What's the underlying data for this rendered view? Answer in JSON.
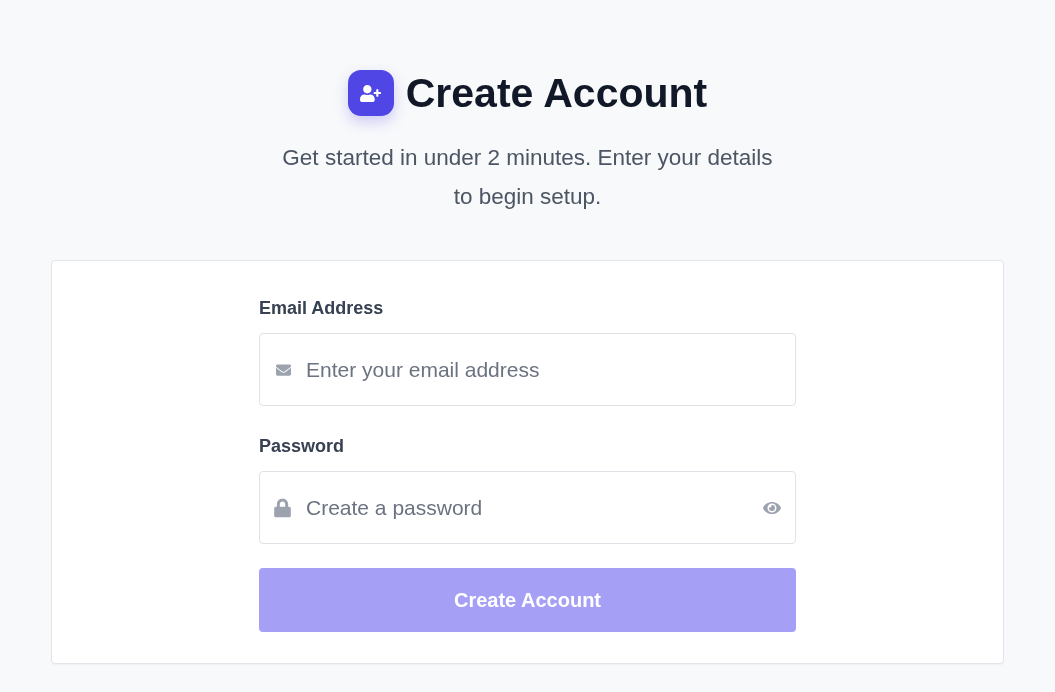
{
  "header": {
    "title": "Create Account",
    "subtitle": "Get started in under 2 minutes. Enter your details to begin setup."
  },
  "form": {
    "fields": [
      {
        "kind": "email",
        "label": "Email Address",
        "placeholder": "Enter your email address"
      },
      {
        "kind": "password",
        "label": "Password",
        "placeholder": "Create a password"
      }
    ],
    "submit": {
      "label": "Create Account",
      "disabled": true
    }
  }
}
